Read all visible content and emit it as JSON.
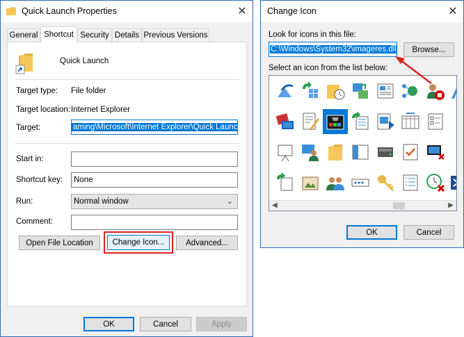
{
  "props_window": {
    "title": "Quick Launch Properties",
    "tabs": [
      "General",
      "Shortcut",
      "Security",
      "Details",
      "Previous Versions"
    ],
    "active_tab": "Shortcut",
    "shortcut_name": "Quick Launch",
    "fields": {
      "target_type_label": "Target type:",
      "target_type_value": "File folder",
      "target_location_label": "Target location:",
      "target_location_value": "Internet Explorer",
      "target_label": "Target:",
      "target_value": "aming\\Microsoft\\Internet Explorer\\Quick Launch\"",
      "start_in_label": "Start in:",
      "start_in_value": "",
      "shortcut_key_label": "Shortcut key:",
      "shortcut_key_value": "None",
      "run_label": "Run:",
      "run_value": "Normal window",
      "comment_label": "Comment:",
      "comment_value": ""
    },
    "buttons": {
      "open_file_location": "Open File Location",
      "change_icon": "Change Icon...",
      "advanced": "Advanced...",
      "ok": "OK",
      "cancel": "Cancel",
      "apply": "Apply"
    }
  },
  "icon_window": {
    "title": "Change Icon",
    "look_for_label": "Look for icons in this file:",
    "file_path": "C:\\Windows\\System32\\imageres.dll",
    "browse": "Browse...",
    "select_label": "Select an icon from the list below:",
    "ok": "OK",
    "cancel": "Cancel"
  },
  "colors": {
    "accent": "#0078d7",
    "highlight_red": "#e02020",
    "titlebar_border": "#2b6ab5"
  }
}
